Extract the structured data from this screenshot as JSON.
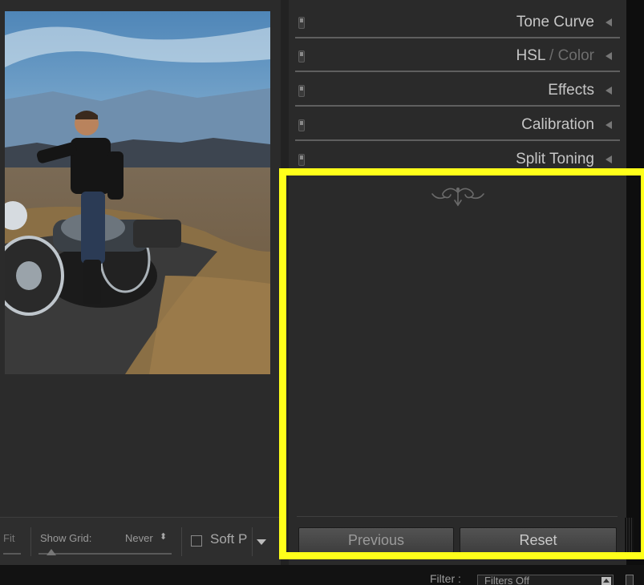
{
  "develop_panels": {
    "sections": [
      {
        "name": "Tone Curve"
      },
      {
        "name": "HSL",
        "name_suffix": " / Color"
      },
      {
        "name": "Effects"
      },
      {
        "name": "Calibration"
      },
      {
        "name": "Split Toning"
      }
    ],
    "previous_label": "Previous",
    "reset_label": "Reset"
  },
  "toolbar": {
    "fit_label": "Fit",
    "show_grid_label": "Show Grid:",
    "show_grid_value": "Never",
    "show_grid_arrows": "⬍",
    "soft_proof_label": "Soft P"
  },
  "filmstrip": {
    "filter_label": "Filter :",
    "filter_value": "Filters Off"
  },
  "highlight_color": "#ffff1a",
  "icons": {
    "panel_switch": "panel-switch-icon",
    "collapse": "collapse-triangle-icon",
    "end_mark": "panel-end-ornament-icon",
    "dropdown": "dropdown-caret-icon"
  }
}
